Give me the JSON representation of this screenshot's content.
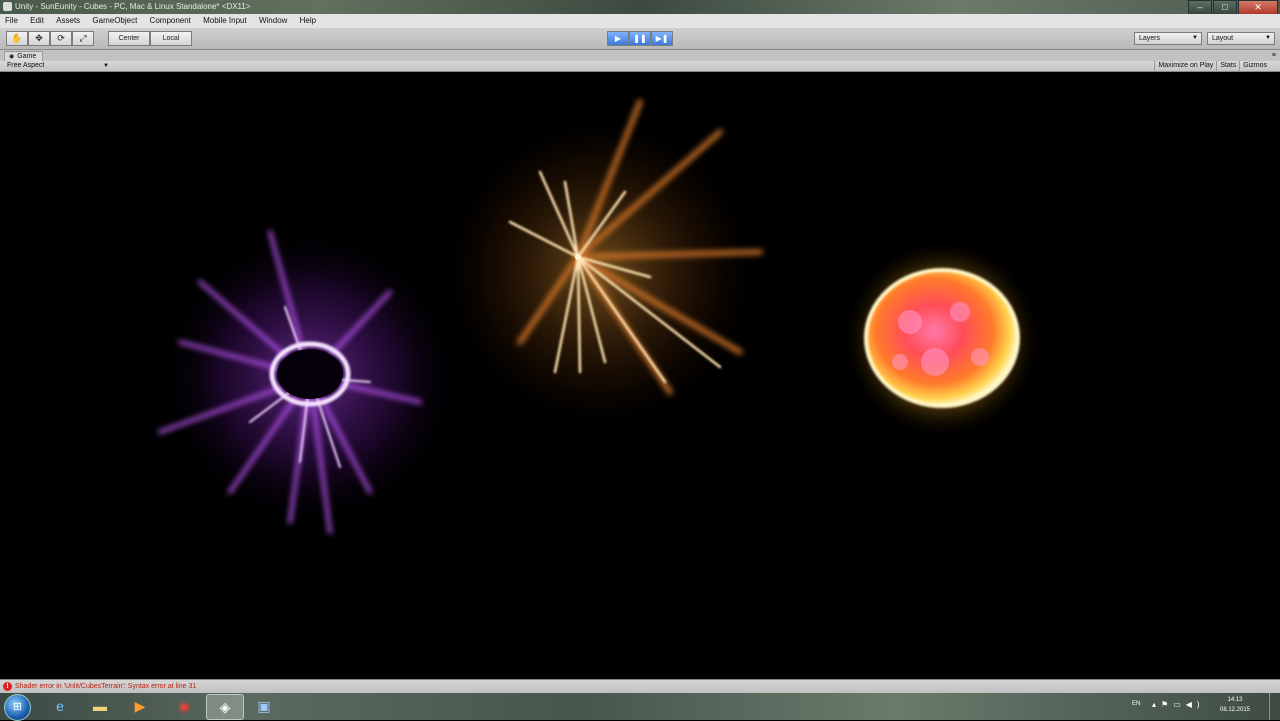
{
  "window": {
    "title": "Unity - SunEunity - Cubes - PC, Mac & Linux Standalone* <DX11>",
    "controls": [
      "–",
      "□",
      "✕"
    ]
  },
  "menu": [
    "File",
    "Edit",
    "Assets",
    "GameObject",
    "Component",
    "Mobile Input",
    "Window",
    "Help"
  ],
  "toolbar": {
    "tools": [
      "hand-icon",
      "move-icon",
      "rotate-icon",
      "scale-icon"
    ],
    "pivot": "Center",
    "space": "Local",
    "play_controls": [
      "play-icon",
      "pause-icon",
      "step-icon"
    ],
    "layers": "Layers",
    "layout": "Layout"
  },
  "game_tab": {
    "label": "Game",
    "aspect": "Free Aspect",
    "buttons": [
      "Maximize on Play",
      "Stats",
      "Gizmos"
    ]
  },
  "status": {
    "error": "Shader error in 'Unlit/CubesTerrain': Syntax error at line 31"
  },
  "taskbar": {
    "apps": [
      "internet-explorer-icon",
      "file-explorer-icon",
      "media-player-icon",
      "chrome-icon",
      "unity-icon",
      "monodevelop-icon"
    ],
    "active_app": "unity-icon",
    "lang": "EN",
    "time": "14:13",
    "date": "08.12.2015"
  },
  "colors": {
    "viewport_bg": "#000000",
    "purple_effect": "#b84dff",
    "spark_effect": "#ffb040",
    "sun_effect": "#ff6a3a"
  }
}
